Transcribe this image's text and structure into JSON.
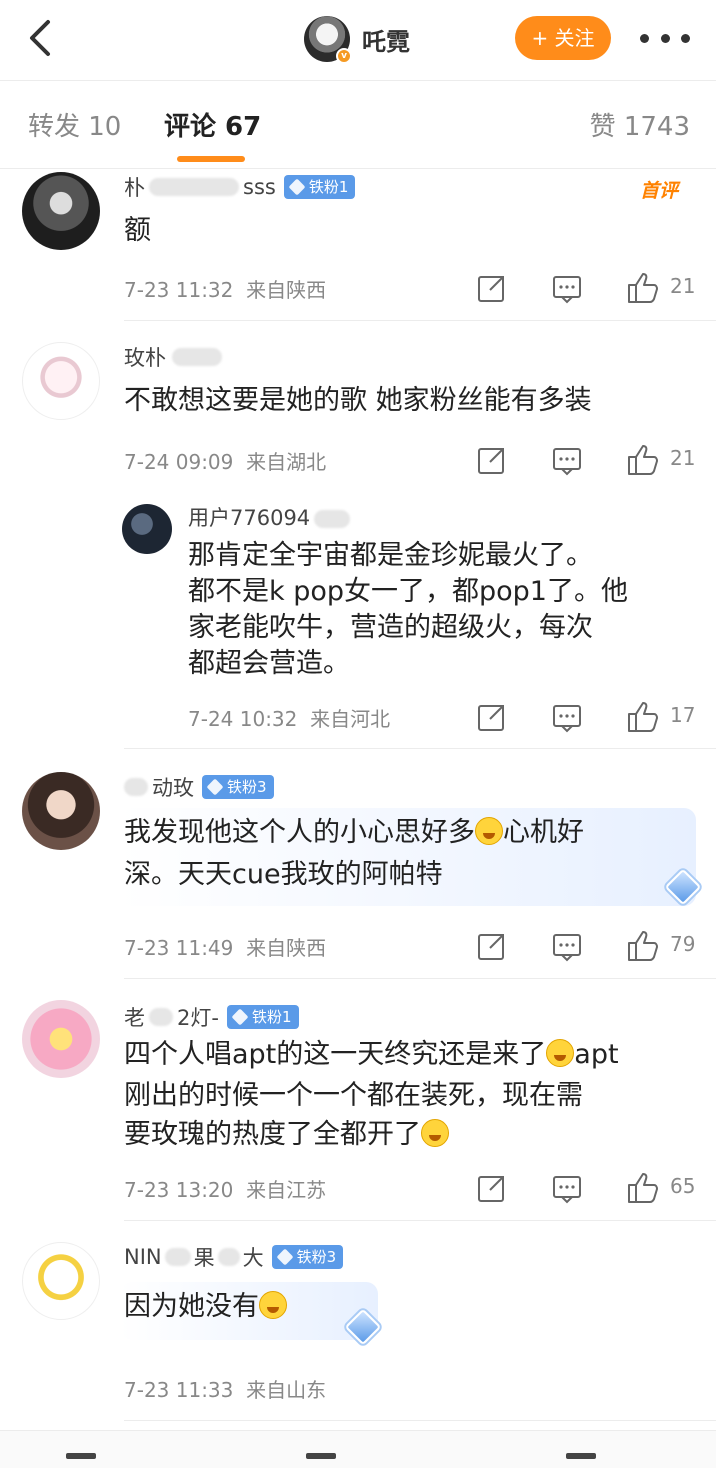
{
  "header": {
    "author_name": "吒霓",
    "follow_label": "+ 关注"
  },
  "tabs": {
    "repost": "转发 10",
    "comment": "评论 67",
    "like": "赞 1743"
  },
  "comments": [
    {
      "user": "朴",
      "user_tail": "sss",
      "badge": "铁粉1",
      "text": "额",
      "time": "7-23 11:32",
      "location": "来自陕西",
      "likes": "21",
      "tag": "首评"
    },
    {
      "user": "玫朴",
      "text": "不敢想这要是她的歌 她家粉丝能有多装",
      "time": "7-24 09:09",
      "location": "来自湖北",
      "likes": "21",
      "reply": {
        "user": "用户776094",
        "lines": [
          "那肯定全宇宙都是金珍妮最火了。",
          "都不是k pop女一了，都pop1了。他",
          "家老能吹牛，营造的超级火，每次",
          "都超会营造。"
        ],
        "time": "7-24 10:32",
        "location": "来自河北",
        "likes": "17"
      }
    },
    {
      "user": "动玫",
      "badge": "铁粉3",
      "line1a": "我发现他这个人的小心思好多",
      "line1b": "心机好",
      "line2": "深。天天cue我玫的阿帕特",
      "time": "7-23 11:49",
      "location": "来自陕西",
      "likes": "79"
    },
    {
      "user": "老",
      "user_tail": "2灯-",
      "badge": "铁粉1",
      "line1a": "四个人唱apt的这一天终究还是来了",
      "line1b": "apt",
      "line2": "刚出的时候一个一个都在装死，现在需",
      "line3": "要玫瑰的热度了全都开了",
      "time": "7-23 13:20",
      "location": "来自江苏",
      "likes": "65"
    },
    {
      "user": "NIN",
      "user_mid": "果",
      "user_tail": "大",
      "badge": "铁粉3",
      "text": "因为她没有",
      "time": "7-23 11:33",
      "location": "来自山东"
    }
  ]
}
